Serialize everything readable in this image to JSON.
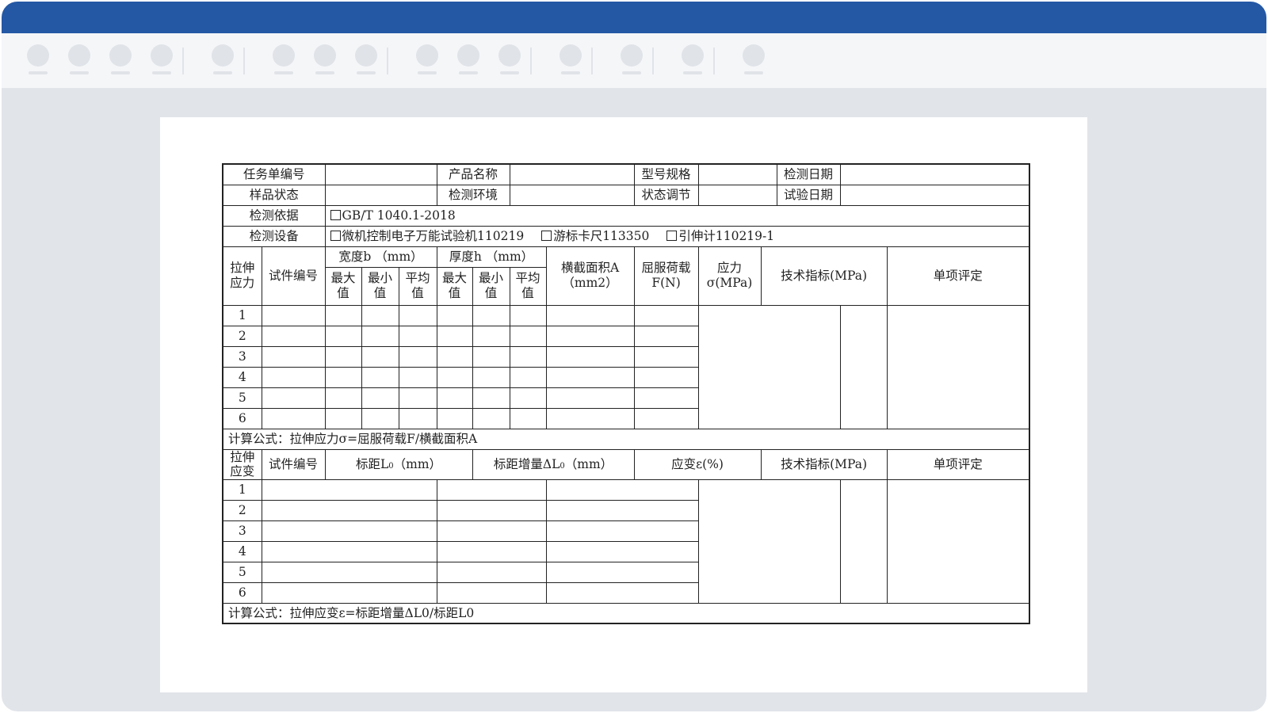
{
  "toolbar": {
    "groups": [
      {
        "icons": [
          "toolbar-icon-1",
          "toolbar-icon-2",
          "toolbar-icon-3",
          "toolbar-icon-4"
        ]
      },
      {
        "icons": [
          "toolbar-icon-5"
        ]
      },
      {
        "icons": [
          "toolbar-icon-6",
          "toolbar-icon-7",
          "toolbar-icon-8"
        ]
      },
      {
        "icons": [
          "toolbar-icon-9",
          "toolbar-icon-10",
          "toolbar-icon-11"
        ]
      },
      {
        "icons": [
          "toolbar-icon-12"
        ]
      },
      {
        "icons": [
          "toolbar-icon-13"
        ]
      },
      {
        "icons": [
          "toolbar-icon-14"
        ]
      },
      {
        "icons": [
          "toolbar-icon-15"
        ]
      }
    ]
  },
  "colors": {
    "titlebar": "#2458a5",
    "workspace": "#e1e4e9",
    "toolbar": "#f5f6f8",
    "toolbar_placeholder": "#e0e3e8"
  },
  "form": {
    "header": {
      "task_no_label": "任务单编号",
      "product_name_label": "产品名称",
      "model_spec_label": "型号规格",
      "test_date_label": "检测日期",
      "sample_state_label": "样品状态",
      "test_env_label": "检测环境",
      "condition_label": "状态调节",
      "trial_date_label": "试验日期",
      "basis_label": "检测依据",
      "basis_options": [
        "GB/T 1040.1-2018"
      ],
      "equipment_label": "检测设备",
      "equipment_options": [
        "微机控制电子万能试验机110219",
        "游标卡尺113350",
        "引伸计110219-1"
      ]
    },
    "stress": {
      "section_label": "拉伸应力",
      "specimen_no": "试件编号",
      "width": "宽度b （mm）",
      "thickness": "厚度h （mm）",
      "max": "最大值",
      "min": "最小值",
      "avg": "平均值",
      "area": "横截面积A（mm2）",
      "yield_load": "屈服荷载F(N)",
      "stress": "应力σ(MPa)",
      "tech_index": "技术指标(MPa)",
      "rating": "单项评定",
      "rows": [
        "1",
        "2",
        "3",
        "4",
        "5",
        "6"
      ],
      "formula": "计算公式：拉伸应力σ=屈服荷载F/横截面积A"
    },
    "strain": {
      "section_label": "拉伸应变",
      "specimen_no": "试件编号",
      "gauge_prefix": "标距L",
      "gauge_sub": "0",
      "gauge_unit": "（mm）",
      "increment_prefix": "标距增量ΔL",
      "increment_sub": "0",
      "increment_unit": "（mm）",
      "strain": "应变ε(%)",
      "tech_index": "技术指标(MPa)",
      "rating": "单项评定",
      "rows": [
        "1",
        "2",
        "3",
        "4",
        "5",
        "6"
      ],
      "formula": "计算公式：拉伸应变ε=标距增量ΔL0/标距L0"
    }
  }
}
